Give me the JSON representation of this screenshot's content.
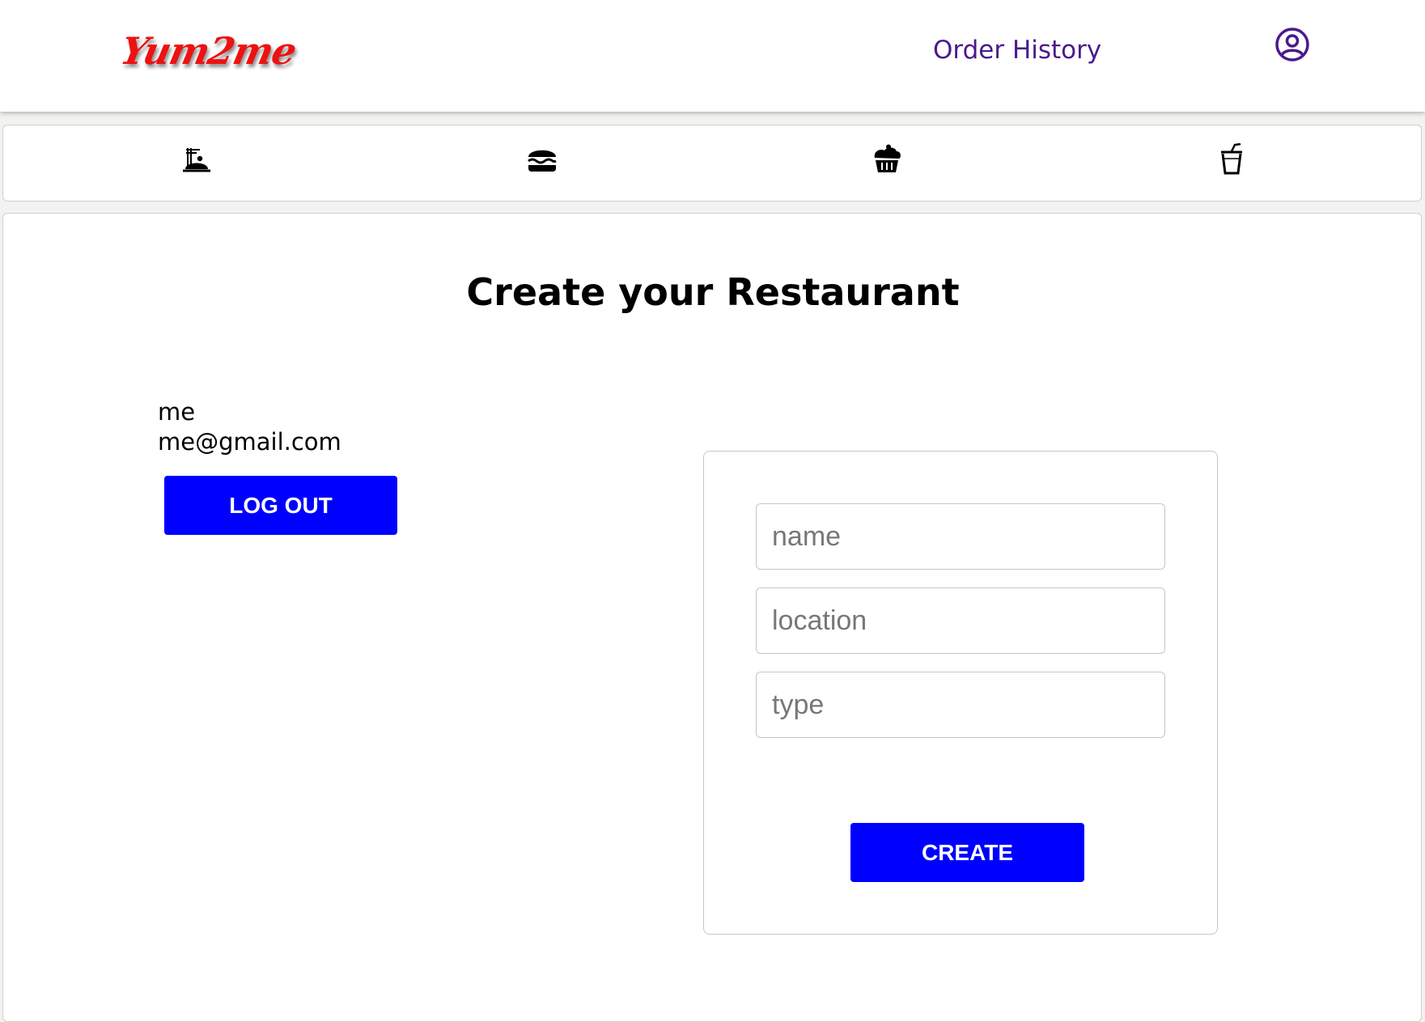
{
  "colors": {
    "brand_red": "#ee1111",
    "nav_purple": "#4a1a8c",
    "button_blue": "#0000ff"
  },
  "header": {
    "logo": "Yum2me",
    "order_history_label": "Order History",
    "profile_icon": "user-circle-icon"
  },
  "categories": [
    {
      "icon": "noodles-icon"
    },
    {
      "icon": "burger-icon"
    },
    {
      "icon": "cupcake-icon"
    },
    {
      "icon": "drink-cup-icon"
    }
  ],
  "main": {
    "title": "Create your Restaurant",
    "user": {
      "name": "me",
      "email": "me@gmail.com"
    },
    "logout_label": "LOG OUT",
    "form": {
      "name_placeholder": "name",
      "location_placeholder": "location",
      "type_placeholder": "type",
      "create_label": "CREATE"
    }
  }
}
